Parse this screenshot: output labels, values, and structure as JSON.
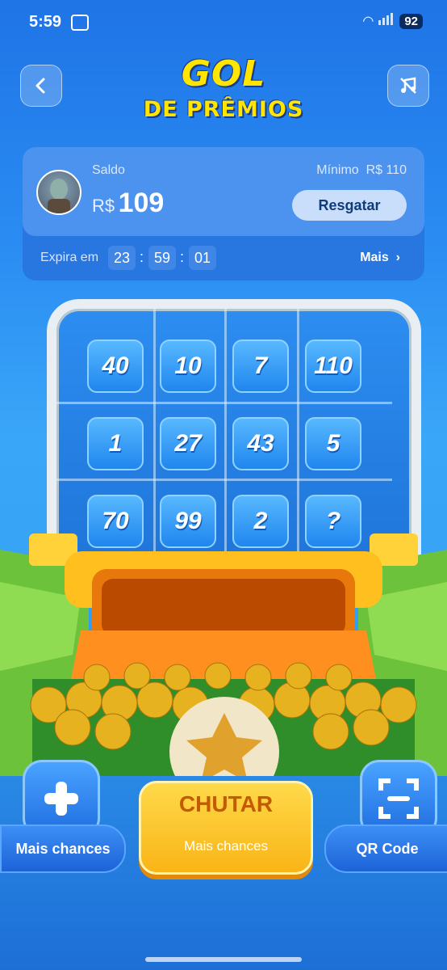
{
  "status_bar": {
    "time": "5:59",
    "battery": "92"
  },
  "header": {
    "title_line1": "GOL",
    "title_line2": "DE PRÊMIOS"
  },
  "balance_card": {
    "saldo_label": "Saldo",
    "currency": "R$",
    "amount": "109",
    "minimum_label": "Mínimo",
    "minimum_value": "R$ 110",
    "redeem_label": "Resgatar",
    "expires_label": "Expira em",
    "timer": {
      "hours": "23",
      "minutes": "59",
      "seconds": "01"
    },
    "more_label": "Mais"
  },
  "prize_grid": [
    [
      "40",
      "10",
      "7",
      "110"
    ],
    [
      "1",
      "27",
      "43",
      "5"
    ],
    [
      "70",
      "99",
      "2",
      "?"
    ]
  ],
  "actions": {
    "kick_label": "CHUTAR",
    "kick_sub_label": "Mais chances",
    "more_chances_label": "Mais chances",
    "qr_label": "QR Code"
  },
  "icons": [
    "back-icon",
    "music-off-icon",
    "plus-icon",
    "qr-scan-icon"
  ],
  "colors": {
    "title_yellow": "#ffe500",
    "kick_button": "#f9b516",
    "primary_blue": "#2876e0"
  }
}
